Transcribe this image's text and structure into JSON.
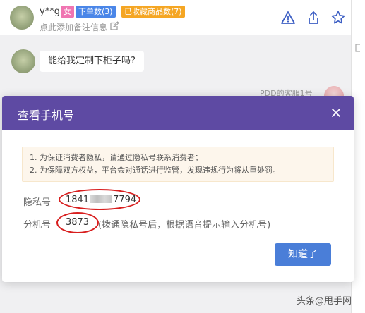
{
  "header": {
    "username": "y**g",
    "tags": {
      "gender": "女",
      "orders": "下单数(3)",
      "favorites": "已收藏商品数(7)"
    },
    "remark_placeholder": "点此添加备注信息"
  },
  "chat": {
    "customer_message": "能给我定制下柜子吗?",
    "agent_name": "PDD的客服1号"
  },
  "dialog": {
    "title": "查看手机号",
    "notices": [
      "1. 为保证消费者隐私，请通过隐私号联系消费者；",
      "2. 为保障双方权益，平台会对通话进行监管，发现违规行为将从重处罚。"
    ],
    "privacy_label": "隐私号",
    "privacy_number_prefix": "1841",
    "privacy_number_suffix": "7794",
    "extension_label": "分机号",
    "extension_number": "3873",
    "extension_hint": "(拨通隐私号后，根据语音提示输入分机号)",
    "confirm_label": "知道了"
  },
  "watermark": "头条@甩手网",
  "colors": {
    "dialog_header": "#5e4aa3",
    "confirm_button": "#4a7ed8",
    "annotation_ring": "#d81e1e",
    "tag_gender": "#f075b2",
    "tag_orders": "#4a86e8",
    "tag_favorites": "#f5a623"
  },
  "icons": [
    "warning-icon",
    "share-icon",
    "star-icon",
    "edit-icon",
    "close-icon"
  ]
}
